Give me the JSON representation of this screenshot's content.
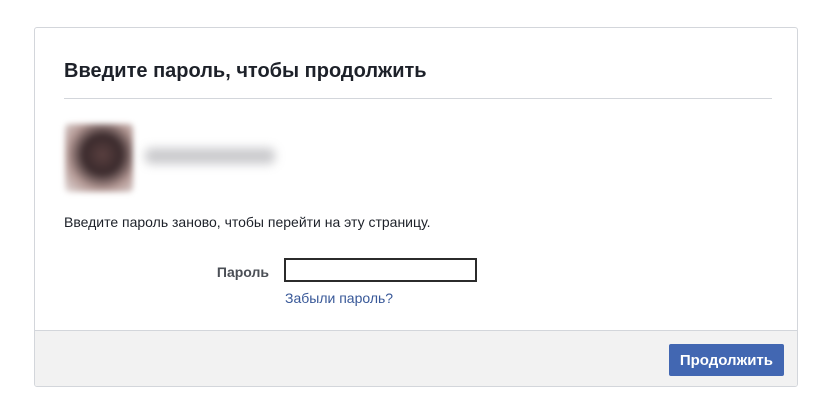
{
  "dialog": {
    "title": "Введите пароль, чтобы продолжить",
    "prompt": "Введите пароль заново, чтобы перейти на эту страницу.",
    "password_label": "Пароль",
    "password_value": "",
    "password_placeholder": "",
    "forgot_link": "Забыли пароль?",
    "continue_button": "Продолжить"
  },
  "colors": {
    "accent": "#4267b2",
    "link": "#385898",
    "footer_bg": "#f2f2f2",
    "border": "#d3d6db"
  }
}
